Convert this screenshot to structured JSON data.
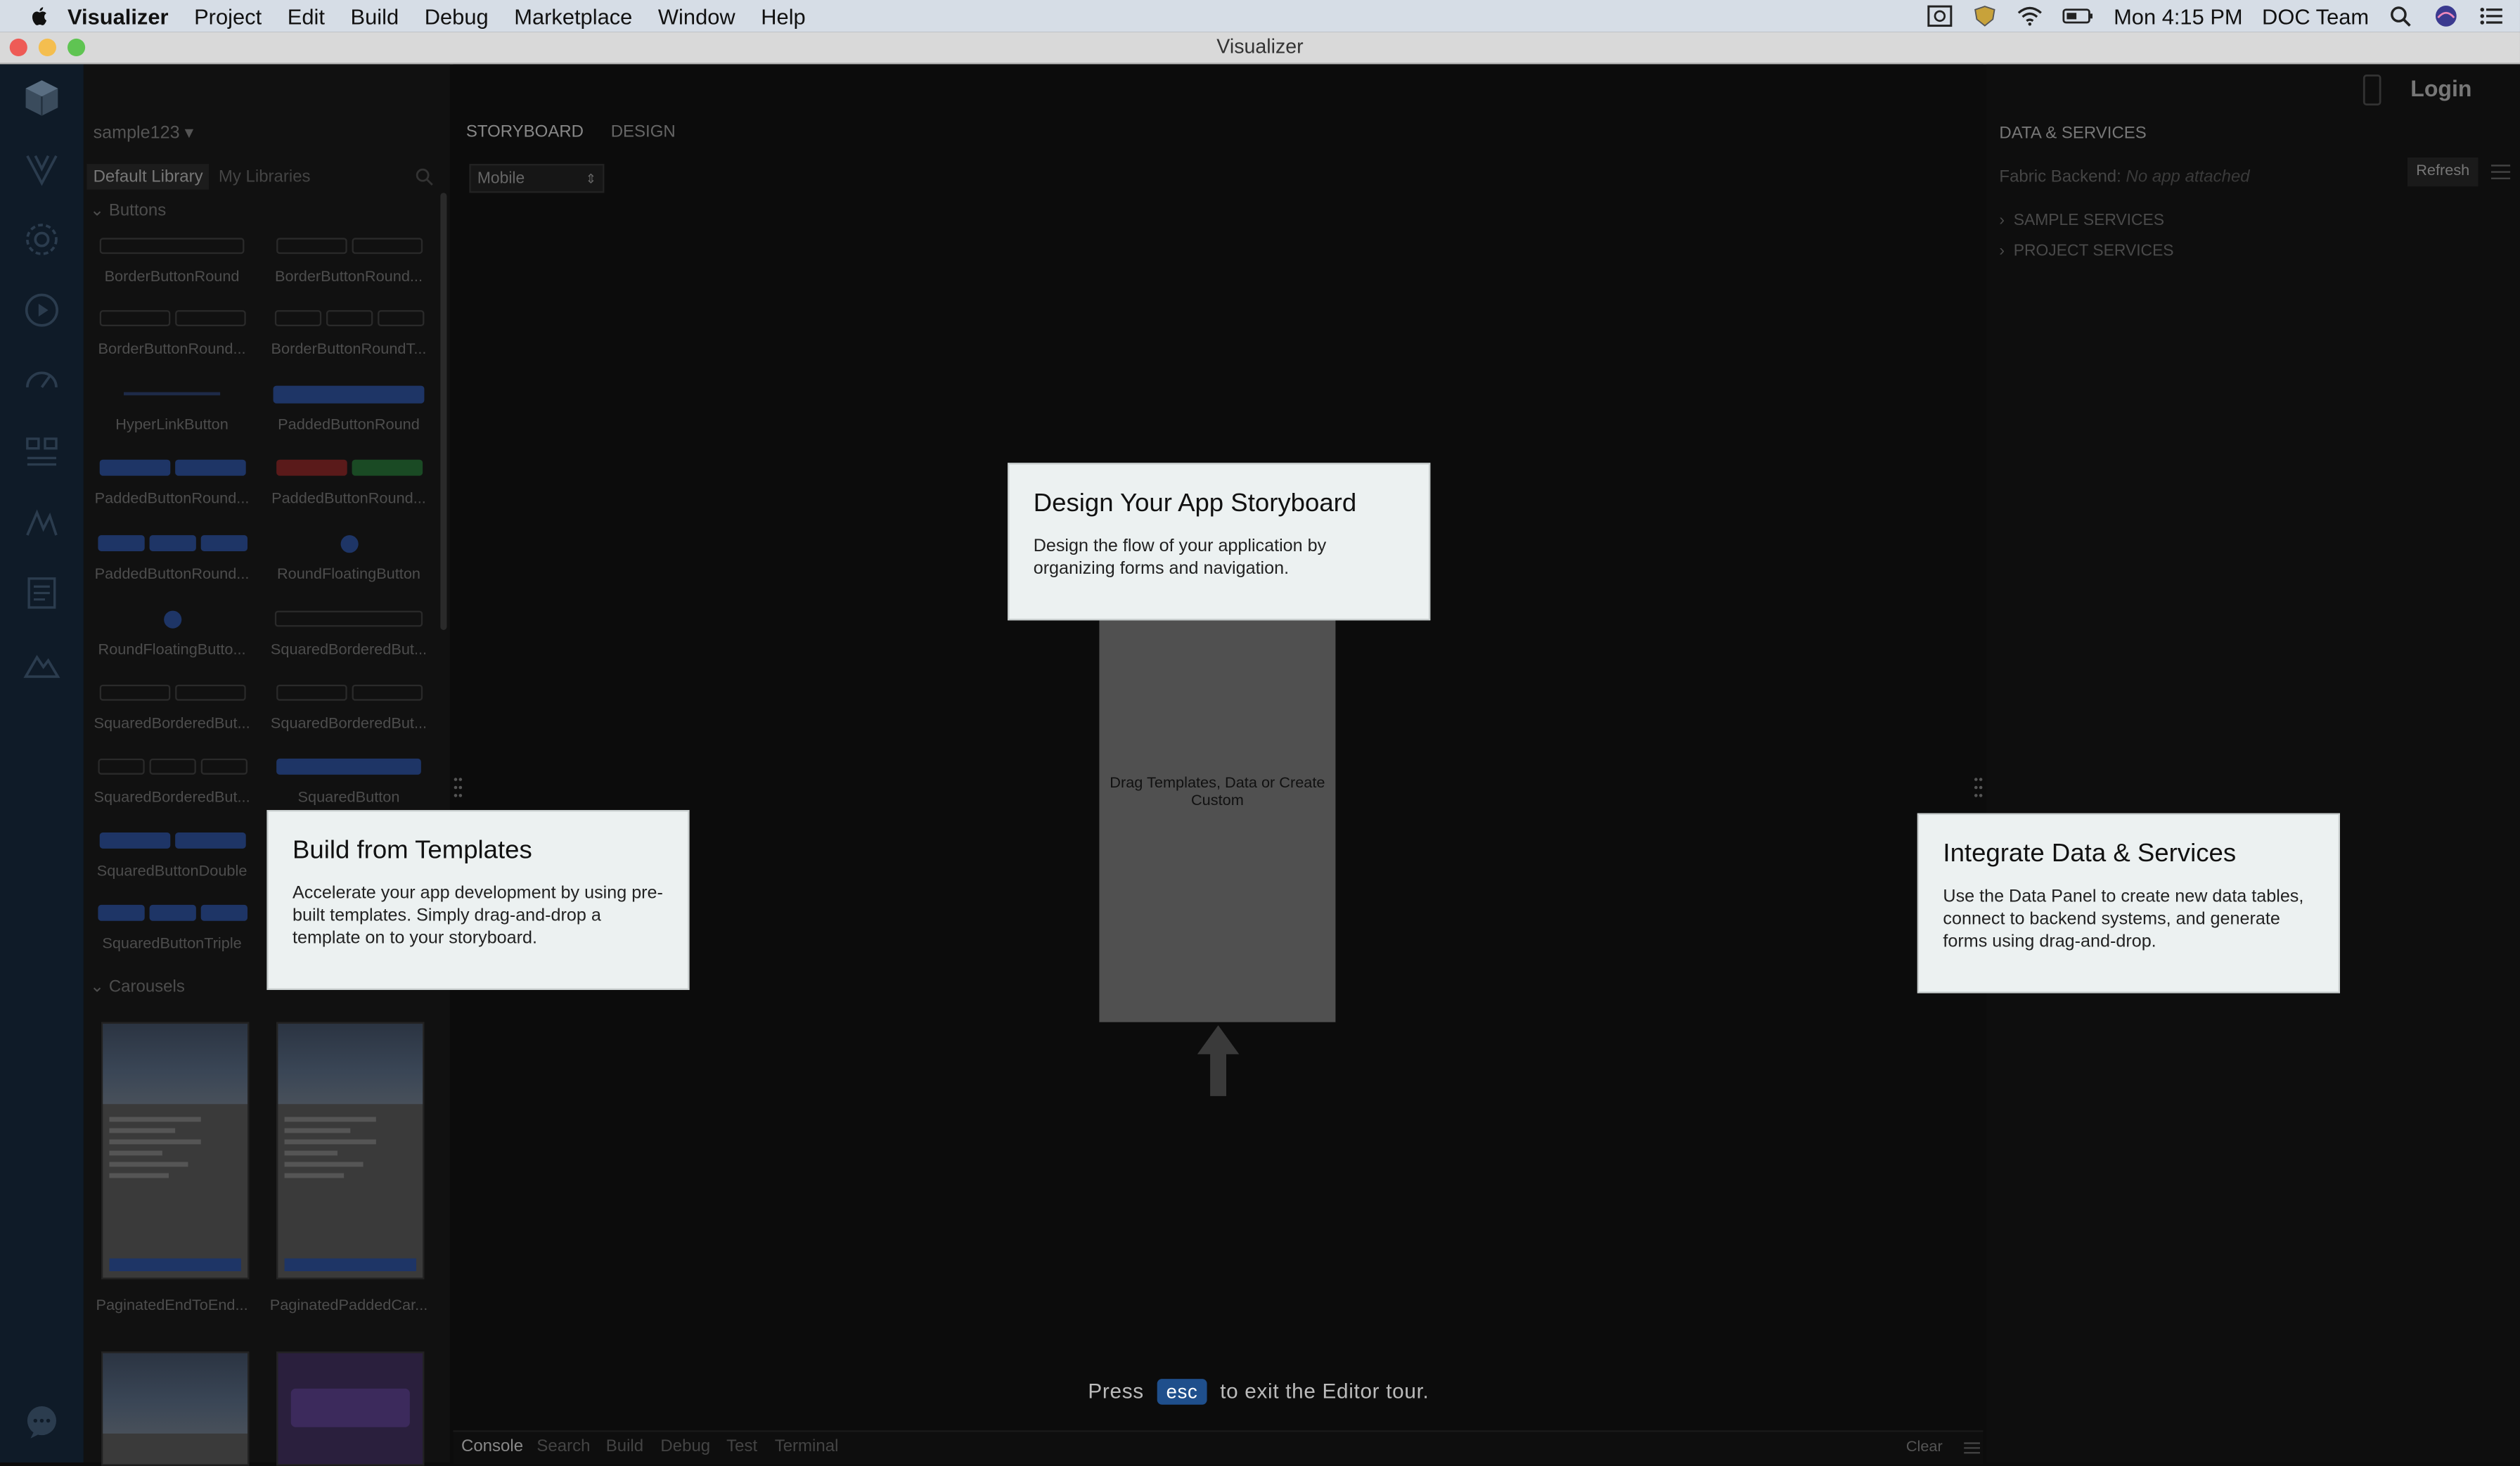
{
  "menubar": {
    "app_name": "Visualizer",
    "items": [
      "Project",
      "Edit",
      "Build",
      "Debug",
      "Marketplace",
      "Window",
      "Help"
    ],
    "clock": "Mon 4:15 PM",
    "user": "DOC Team"
  },
  "window": {
    "title": "Visualizer"
  },
  "header": {
    "login_label": "Login"
  },
  "library": {
    "project": "sample123",
    "tabs": [
      "Default Library",
      "My Libraries"
    ],
    "sections": [
      "Buttons",
      "Carousels"
    ],
    "widgets": [
      "BorderButtonRound",
      "BorderButtonRound...",
      "BorderButtonRound...",
      "BorderButtonRoundT...",
      "HyperLinkButton",
      "PaddedButtonRound",
      "PaddedButtonRound...",
      "PaddedButtonRound...",
      "PaddedButtonRound...",
      "RoundFloatingButton",
      "RoundFloatingButto...",
      "SquaredBorderedBut...",
      "SquaredBorderedBut...",
      "SquaredBorderedBut...",
      "SquaredBorderedBut...",
      "SquaredButton",
      "SquaredButtonDouble",
      "",
      "SquaredButtonTriple",
      ""
    ],
    "carousels": [
      "PaginatedEndToEnd...",
      "PaginatedPaddedCar..."
    ]
  },
  "canvas": {
    "tabs": [
      "STORYBOARD",
      "DESIGN"
    ],
    "device": "Mobile",
    "drop_hint": "Drag Templates, Data or Create Custom"
  },
  "bottom_tabs": [
    "Console",
    "Search",
    "Build",
    "Debug",
    "Test",
    "Terminal"
  ],
  "bottom_clear": "Clear",
  "data_panel": {
    "title": "DATA & SERVICES",
    "backend_label": "Fabric Backend:",
    "backend_value": "No app attached",
    "refresh": "Refresh",
    "items": [
      "SAMPLE SERVICES",
      "PROJECT SERVICES"
    ]
  },
  "tour": {
    "storyboard": {
      "title": "Design Your App Storyboard",
      "body": "Design the flow of your application by organizing forms and navigation."
    },
    "templates": {
      "title": "Build from Templates",
      "body": "Accelerate your app development by using pre-built templates. Simply drag-and-drop a template on to your storyboard."
    },
    "data": {
      "title": "Integrate Data & Services",
      "body": "Use the Data Panel to create new data tables, connect to backend systems, and generate forms using drag-and-drop."
    },
    "esc_prefix": "Press",
    "esc_key": "esc",
    "esc_suffix": "to exit the Editor tour."
  }
}
